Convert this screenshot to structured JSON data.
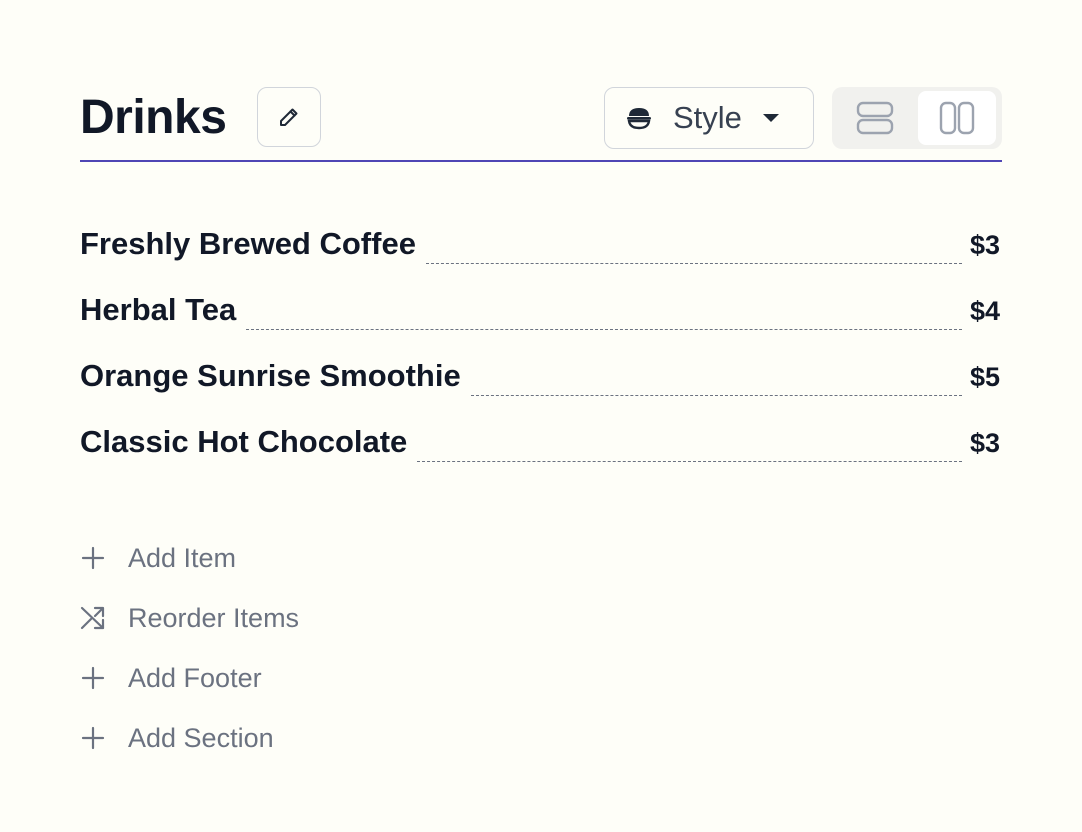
{
  "section": {
    "title": "Drinks",
    "accent_color": "#4f46b5",
    "edit_icon": "pencil-icon"
  },
  "toolbar": {
    "style_label": "Style",
    "style_icon": "bowl-icon",
    "layout_options": [
      {
        "name": "rows-layout",
        "icon": "rows-icon",
        "selected": false
      },
      {
        "name": "columns-layout",
        "icon": "columns-icon",
        "selected": true
      }
    ]
  },
  "items": [
    {
      "name": "Freshly Brewed Coffee",
      "price": "$3"
    },
    {
      "name": "Herbal Tea",
      "price": "$4"
    },
    {
      "name": "Orange Sunrise Smoothie",
      "price": "$5"
    },
    {
      "name": "Classic Hot Chocolate",
      "price": "$3"
    }
  ],
  "actions": [
    {
      "label": "Add Item",
      "icon": "plus-icon"
    },
    {
      "label": "Reorder Items",
      "icon": "shuffle-icon"
    },
    {
      "label": "Add Footer",
      "icon": "plus-icon"
    },
    {
      "label": "Add Section",
      "icon": "plus-icon"
    }
  ]
}
